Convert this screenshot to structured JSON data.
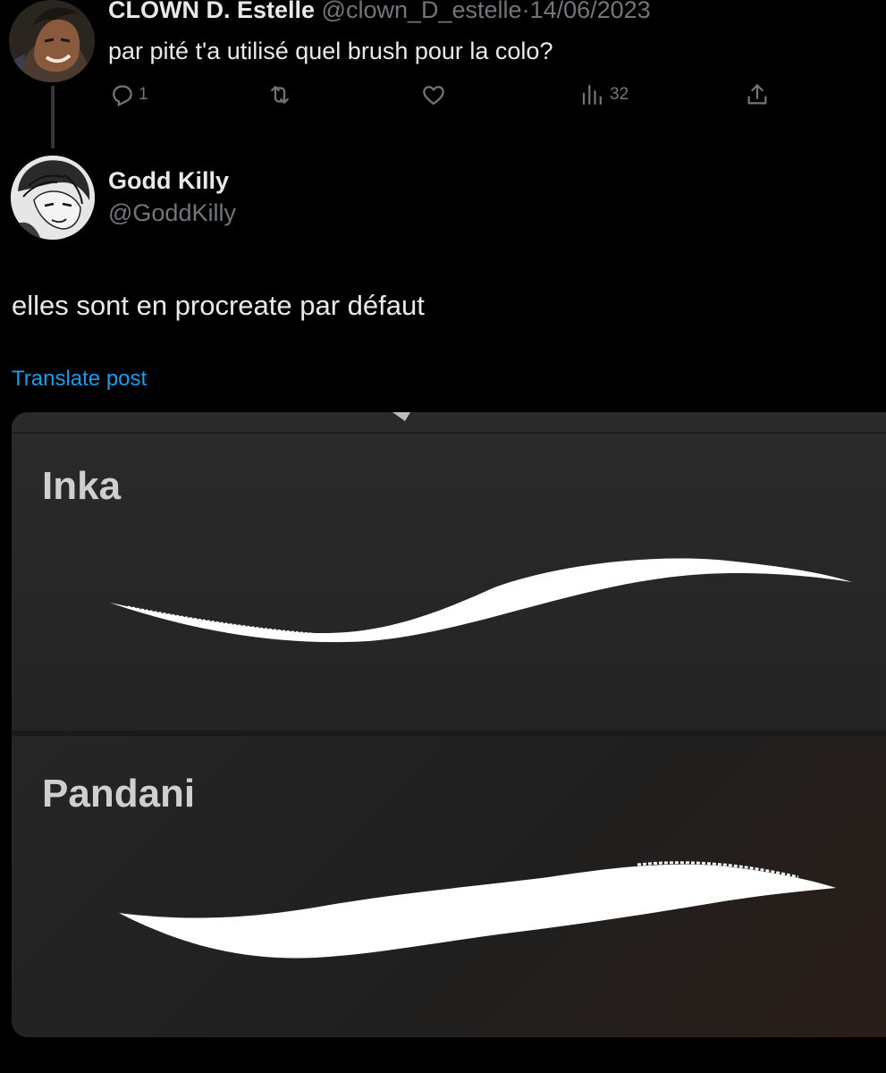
{
  "parent_tweet": {
    "display_name": "CLOWN D. Estelle",
    "handle": "@clown_D_estelle",
    "separator": "·",
    "date": "14/06/2023",
    "text": "par pité t'a utilisé quel brush pour la colo?",
    "actions": {
      "reply_count": "1",
      "retweet_count": "",
      "like_count": "",
      "views_count": "32"
    }
  },
  "reply_tweet": {
    "display_name": "Godd Killy",
    "handle": "@GoddKilly",
    "text": "elles sont en procreate par défaut",
    "translate_label": "Translate post"
  },
  "media": {
    "brushes": [
      {
        "name": "Inka"
      },
      {
        "name": "Pandani"
      }
    ]
  },
  "icons": {
    "reply": "reply-icon",
    "retweet": "retweet-icon",
    "like": "like-icon",
    "views": "views-icon",
    "share": "share-icon"
  },
  "colors": {
    "background": "#000000",
    "primary_text": "#e7e9ea",
    "secondary_text": "#71767b",
    "link": "#1d9bf0"
  }
}
